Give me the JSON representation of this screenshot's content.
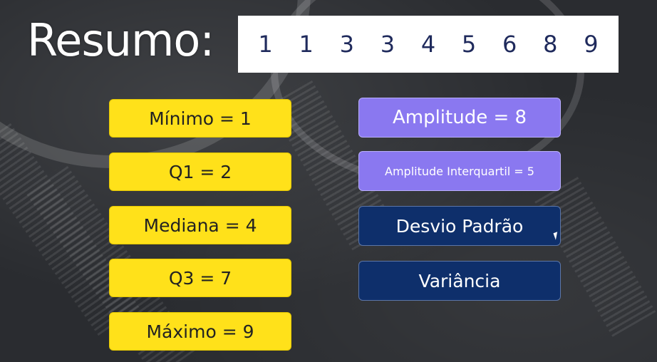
{
  "title": "Resumo:",
  "numbers": [
    "1",
    "1",
    "3",
    "3",
    "4",
    "5",
    "6",
    "8",
    "9"
  ],
  "stats_left": [
    "Mínimo = 1",
    "Q1 = 2",
    "Mediana = 4",
    "Q3 = 7",
    "Máximo = 9"
  ],
  "stats_right": [
    "Amplitude = 8",
    "Amplitude Interquartil = 5",
    "Desvio Padrão",
    "Variância"
  ],
  "colors": {
    "yellow_box": "#ffe11a",
    "purple_box": "#8a78f0",
    "navy_box": "#0e2f6b",
    "number_text": "#1f2a5c"
  }
}
